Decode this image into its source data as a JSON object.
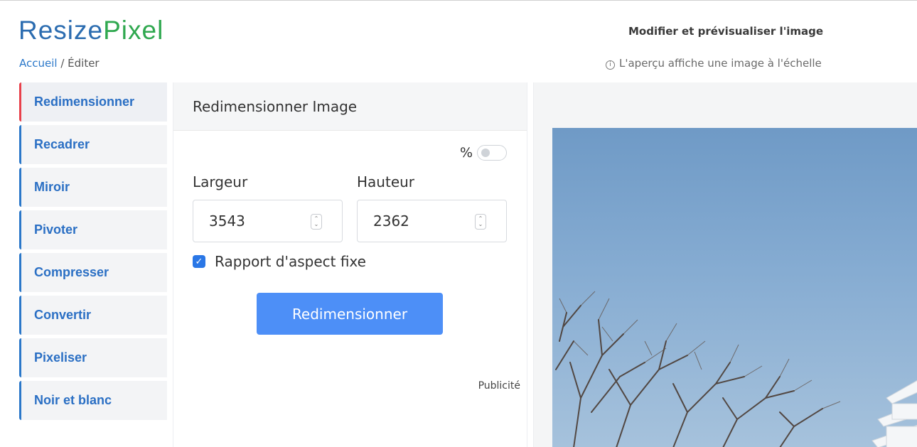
{
  "brand": {
    "part1": "Resize",
    "part2": "Pixel"
  },
  "breadcrumb": {
    "home": "Accueil",
    "separator": " / ",
    "current": "Éditer"
  },
  "header": {
    "title": "Modifier et prévisualiser l'image",
    "note": "L'aperçu affiche une image à l'échelle",
    "note_icon": "info-icon"
  },
  "sidebar": {
    "items": [
      {
        "label": "Redimensionner",
        "active": true
      },
      {
        "label": "Recadrer"
      },
      {
        "label": "Miroir"
      },
      {
        "label": "Pivoter"
      },
      {
        "label": "Compresser"
      },
      {
        "label": "Convertir"
      },
      {
        "label": "Pixeliser"
      },
      {
        "label": "Noir et blanc"
      }
    ]
  },
  "resize_panel": {
    "title": "Redimensionner Image",
    "percent_label": "%",
    "percent_toggle_on": false,
    "width_label": "Largeur",
    "width_value": "3543",
    "height_label": "Hauteur",
    "height_value": "2362",
    "aspect_label": "Rapport d'aspect fixe",
    "aspect_checked": true,
    "submit_label": "Redimensionner",
    "ad_label": "Publicité"
  },
  "colors": {
    "accent_blue": "#4d8ff7",
    "link_blue": "#2a77c9",
    "active_marker": "#e8404a",
    "logo_green": "#2fa84f"
  }
}
